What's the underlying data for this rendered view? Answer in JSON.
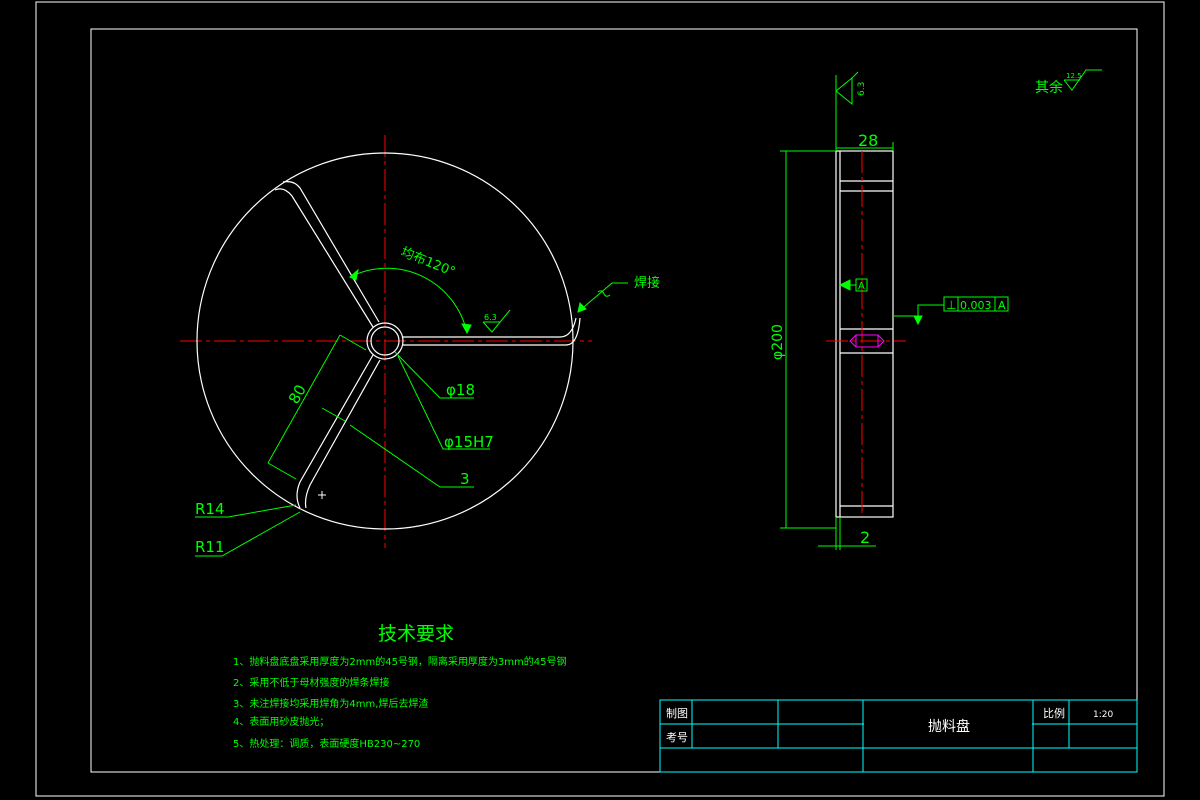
{
  "drawing": {
    "title": "抛料盘",
    "scale_label": "比例",
    "scale_value": "1:20",
    "drawn_by_label": "制图",
    "checked_by_label": "考号",
    "roughness_general_label": "其余",
    "roughness_general_value": "12.5",
    "roughness_face_value": "6.3",
    "roughness_slot_value": "6.3"
  },
  "front_view": {
    "angle_label": "均布120°",
    "weld_label": "焊接",
    "dim_80": "80",
    "dim_hole_outer": "φ18",
    "dim_hole_inner": "φ15H7",
    "dim_width_3": "3",
    "dim_r14": "R14",
    "dim_r11": "R11"
  },
  "side_view": {
    "dim_28": "28",
    "dim_200": "φ200",
    "dim_2": "2",
    "datum_label": "A",
    "tolerance_symbol": "⊥",
    "tolerance_value": "0.003",
    "tolerance_datum": "A"
  },
  "tech_requirements": {
    "heading": "技术要求",
    "items": [
      "1、抛料盘底盘采用厚度为2mm的45号钢，隔离采用厚度为3mm的45号钢",
      "2、采用不低于母材强度的焊条焊接",
      "3、未注焊接均采用焊角为4mm,焊后去焊渣",
      "4、表面用砂皮抛光；",
      "5、热处理：调质，表面硬度HB230~270"
    ]
  },
  "colors": {
    "background": "#000000",
    "outline": "#ffffff",
    "centerline": "#ff0000",
    "dimension": "#00ff00",
    "symbol": "#ff00ff"
  }
}
